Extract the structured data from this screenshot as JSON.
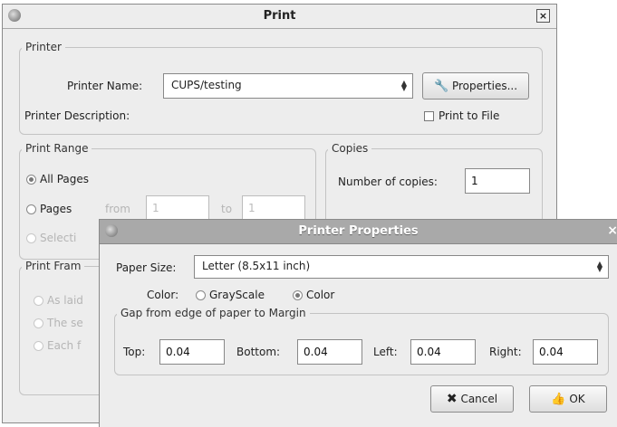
{
  "print_dialog": {
    "title": "Print",
    "close": "×",
    "printer": {
      "legend": "Printer",
      "name_label": "Printer Name:",
      "name_value": "CUPS/testing",
      "properties_button": "Properties...",
      "description_label": "Printer Description:",
      "print_to_file_label": "Print to File"
    },
    "range": {
      "legend": "Print Range",
      "all_pages": "All Pages",
      "pages": "Pages",
      "from_label": "from",
      "from_value": "1",
      "to_label": "to",
      "to_value": "1",
      "selection_partial": "Selecti"
    },
    "copies": {
      "legend": "Copies",
      "number_label": "Number of copies:",
      "number_value": "1"
    },
    "frames": {
      "legend_partial": "Print Fram",
      "opt1_partial": "As laid",
      "opt2_partial": "The se",
      "opt3_partial": "Each f"
    }
  },
  "properties_dialog": {
    "title": "Printer Properties",
    "close": "×",
    "paper_size_label": "Paper Size:",
    "paper_size_value": "Letter (8.5x11 inch)",
    "color_label": "Color:",
    "grayscale_label": "GrayScale",
    "color_option_label": "Color",
    "margin_legend": "Gap from edge of paper to Margin",
    "top_label": "Top:",
    "top_value": "0.04",
    "bottom_label": "Bottom:",
    "bottom_value": "0.04",
    "left_label": "Left:",
    "left_value": "0.04",
    "right_label": "Right:",
    "right_value": "0.04",
    "cancel_button": "Cancel",
    "ok_button": "OK"
  },
  "colors": {
    "window_bg": "#ededed",
    "border": "#8a8a8a",
    "disabled_text": "#b5b5b5"
  }
}
